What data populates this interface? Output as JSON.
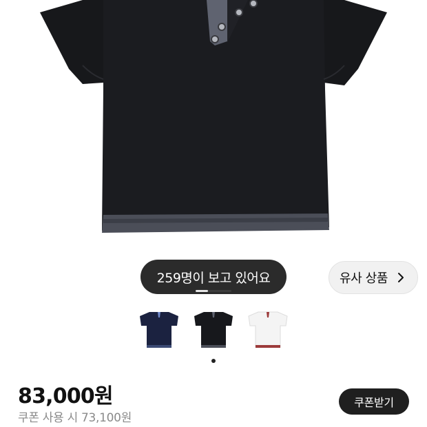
{
  "viewers_pill": "259명이 보고 있어요",
  "similar_button": "유사 상품",
  "gallery_progress": 0.35,
  "thumbnails": [
    {
      "name": "navy",
      "color": "#1b2240"
    },
    {
      "name": "black",
      "color": "#17181c"
    },
    {
      "name": "white",
      "color": "#f4f4f4"
    }
  ],
  "price": "83,000원",
  "coupon_price": "쿠폰 사용 시 73,100원",
  "coupon_button": "쿠폰받기"
}
